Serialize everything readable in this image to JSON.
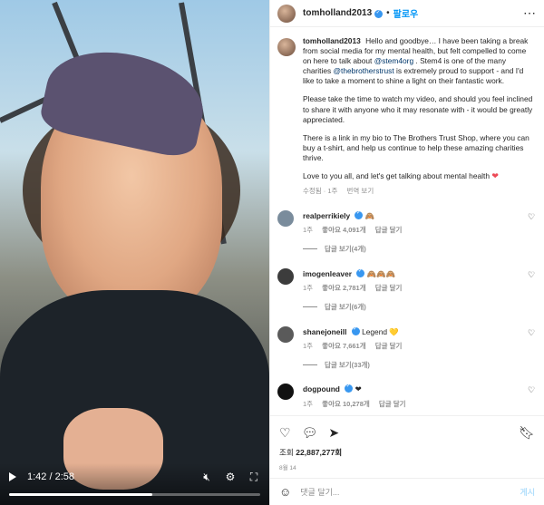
{
  "video": {
    "time": "1:42 / 2:58",
    "progress": 0.57,
    "icons": {
      "play": "play-icon",
      "mute": "volume-muted-icon",
      "settings": "gear-icon",
      "fullscreen": "fullscreen-icon"
    }
  },
  "header": {
    "username": "tomholland2013",
    "follow_label": "팔로우",
    "more": "⋯"
  },
  "caption": {
    "username": "tomholland2013",
    "p1_a": "Hello and goodbye… I have been taking a break from social media for my mental health, but felt compelled to come on here to talk about ",
    "p1_link1": "@stem4org",
    "p1_b": " . Stem4 is one of the many charities ",
    "p1_link2": "@thebrotherstrust",
    "p1_c": " is extremely proud to support - and I'd like to take a moment to shine a light on their fantastic work.",
    "p2": "Please take the time to watch my video, and should you feel inclined to share it with anyone who it may resonate with - it would be greatly appreciated.",
    "p3": "There is a link in my bio to The Brothers Trust Shop, where you can buy a t-shirt, and help us continue to help these amazing charities thrive.",
    "p4": "Love to you all, and let's get talking about mental health",
    "edited": "수정됨 · 1주",
    "translate": "번역 보기"
  },
  "comments": [
    {
      "user": "realperrikiely",
      "text": "🙈",
      "age": "1주",
      "likes": "좋아요 4,091개",
      "reply": "답글 달기",
      "replies": "답글 보기(4개)",
      "avatar_color": "#7a8c9c"
    },
    {
      "user": "imogenleaver",
      "text": "🙈🙈🙈",
      "age": "1주",
      "likes": "좋아요 2,781개",
      "reply": "답글 달기",
      "replies": "답글 보기(6개)",
      "avatar_color": "#3c3c3c"
    },
    {
      "user": "shanejoneill",
      "text": "Legend 💛",
      "age": "1주",
      "likes": "좋아요 7,661개",
      "reply": "답글 달기",
      "replies": "답글 보기(33개)",
      "avatar_color": "#5a5a5a"
    },
    {
      "user": "dogpound",
      "text": "❤",
      "age": "1주",
      "likes": "좋아요 10,278개",
      "reply": "답글 달기",
      "replies": "",
      "avatar_color": "#111111"
    }
  ],
  "actions": {
    "views_label": "조회",
    "views_count": "22,887,277회",
    "date": "8월 14"
  },
  "add_comment": {
    "placeholder": "댓글 달기...",
    "post_label": "게시"
  }
}
